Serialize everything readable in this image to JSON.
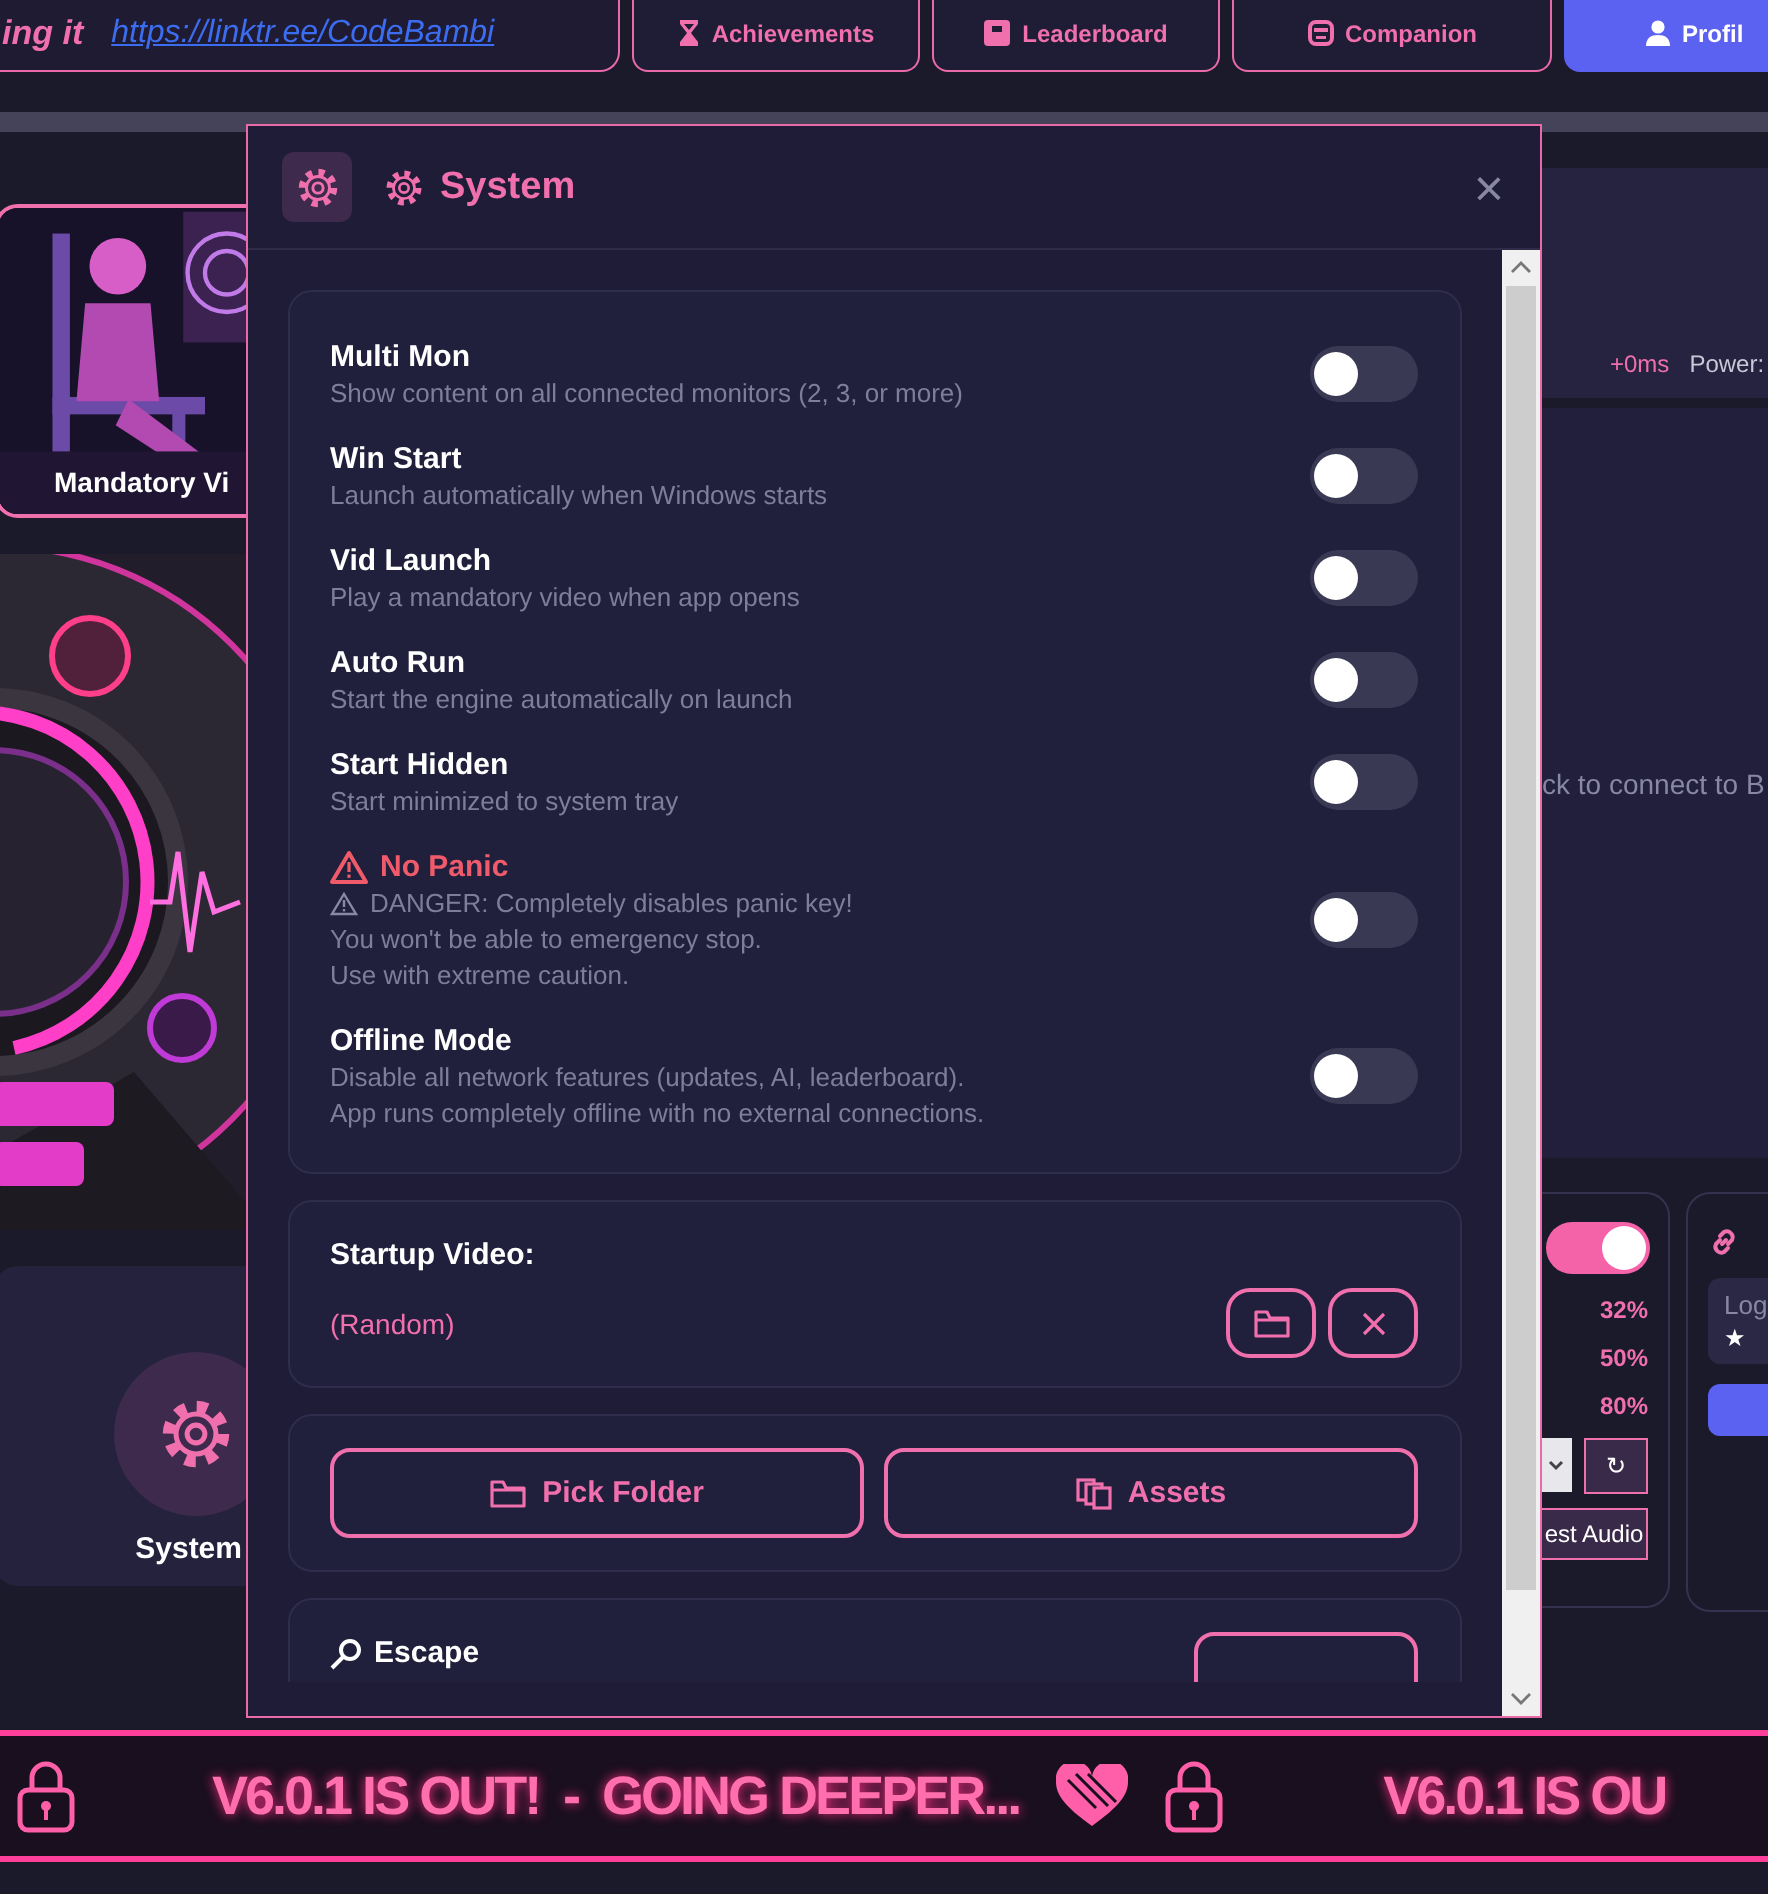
{
  "header": {
    "tagline": "ing it",
    "link": "https://linktr.ee/CodeBambi",
    "nav": [
      {
        "label": "Achievements",
        "selected": false
      },
      {
        "label": "Leaderboard",
        "selected": false
      },
      {
        "label": "Companion",
        "selected": false
      },
      {
        "label": "Profil",
        "selected": true
      }
    ]
  },
  "left": {
    "video_card": {
      "label": "Mandatory Vi",
      "kind": "picture"
    },
    "system_tile": {
      "label": "System"
    }
  },
  "right": {
    "latency": "+0ms",
    "power_label": "Power:",
    "connect_hint": "ck to connect to B",
    "audio": {
      "on": true,
      "readings": [
        "32%",
        "50%",
        "80%"
      ],
      "refresh": "↻",
      "test_button": "est Audio"
    },
    "link_card": {
      "login_label": "Log",
      "star": "★"
    }
  },
  "dialog": {
    "title": "System",
    "close": "×",
    "settings": [
      {
        "title": "Multi Mon",
        "danger": false,
        "on": false,
        "description": [
          "Show content on all connected monitors (2, 3, or more)"
        ]
      },
      {
        "title": "Win Start",
        "danger": false,
        "on": false,
        "description": [
          "Launch automatically when Windows starts"
        ]
      },
      {
        "title": "Vid Launch",
        "danger": false,
        "on": false,
        "description": [
          "Play a mandatory video when app opens"
        ]
      },
      {
        "title": "Auto Run",
        "danger": false,
        "on": false,
        "description": [
          "Start the engine automatically on launch"
        ]
      },
      {
        "title": "Start Hidden",
        "danger": false,
        "on": false,
        "description": [
          "Start minimized to system tray"
        ]
      },
      {
        "title": "No Panic",
        "danger": true,
        "on": false,
        "description": [
          "DANGER: Completely disables panic key!",
          "You won't be able to emergency stop.",
          "Use with extreme caution."
        ]
      },
      {
        "title": "Offline Mode",
        "danger": false,
        "on": false,
        "description": [
          "Disable all network features (updates, AI, leaderboard).",
          "App runs completely offline with no external connections."
        ]
      }
    ],
    "startup_video": {
      "label": "Startup Video:",
      "value": "(Random)"
    },
    "actions": [
      {
        "label": "Pick Folder"
      },
      {
        "label": "Assets"
      }
    ],
    "escape": {
      "label": "Escape"
    }
  },
  "ticker": {
    "items": [
      "V6.0.1 IS OUT!  -  GOING DEEPER...",
      "V6.0.1 IS OU"
    ]
  }
}
